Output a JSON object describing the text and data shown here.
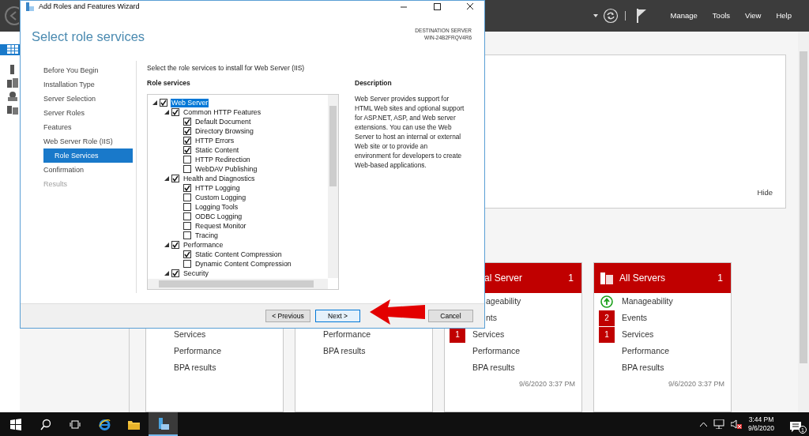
{
  "server_manager": {
    "menu": [
      "Manage",
      "Tools",
      "View",
      "Help"
    ],
    "hide_label": "Hide",
    "tiles": [
      {
        "rows": [
          {
            "kind": "plain",
            "label": "Services"
          },
          {
            "kind": "plain",
            "label": "Performance"
          },
          {
            "kind": "plain",
            "label": "BPA results"
          }
        ]
      },
      {
        "rows": [
          {
            "kind": "plain",
            "label": "Performance"
          },
          {
            "kind": "plain",
            "label": "BPA results"
          }
        ]
      },
      {
        "title": "al Server",
        "count": "1",
        "rows": [
          {
            "kind": "plain",
            "label": "ageability"
          },
          {
            "kind": "plain",
            "label": "nts"
          },
          {
            "kind": "count",
            "count": "1",
            "label": "Services"
          },
          {
            "kind": "plain",
            "label": "Performance"
          },
          {
            "kind": "plain",
            "label": "BPA results"
          }
        ],
        "timestamp": "9/6/2020 3:37 PM"
      },
      {
        "title": "All Servers",
        "count": "1",
        "rows": [
          {
            "kind": "status",
            "label": "Manageability"
          },
          {
            "kind": "count",
            "count": "2",
            "label": "Events"
          },
          {
            "kind": "count",
            "count": "1",
            "label": "Services"
          },
          {
            "kind": "plain",
            "label": "Performance"
          },
          {
            "kind": "plain",
            "label": "BPA results"
          }
        ],
        "timestamp": "9/6/2020 3:37 PM"
      }
    ]
  },
  "wizard": {
    "title": "Add Roles and Features Wizard",
    "heading": "Select role services",
    "destination_label": "DESTINATION SERVER",
    "destination_server": "WIN-24B2FRQV4R6",
    "steps": [
      {
        "label": "Before You Begin",
        "selected": false,
        "disabled": false
      },
      {
        "label": "Installation Type",
        "selected": false,
        "disabled": false
      },
      {
        "label": "Server Selection",
        "selected": false,
        "disabled": false
      },
      {
        "label": "Server Roles",
        "selected": false,
        "disabled": false
      },
      {
        "label": "Features",
        "selected": false,
        "disabled": false
      },
      {
        "label": "Web Server Role (IIS)",
        "selected": false,
        "disabled": false,
        "children": [
          {
            "label": "Role Services",
            "selected": true,
            "disabled": false
          }
        ]
      },
      {
        "label": "Confirmation",
        "selected": false,
        "disabled": false
      },
      {
        "label": "Results",
        "selected": false,
        "disabled": true
      }
    ],
    "intro": "Select the role services to install for Web Server (IIS)",
    "role_services_label": "Role services",
    "tree": [
      {
        "label": "Web Server",
        "checked": true,
        "expanded": true,
        "selected": true,
        "children": [
          {
            "label": "Common HTTP Features",
            "checked": true,
            "expanded": true,
            "selected": false,
            "children": [
              {
                "label": "Default Document",
                "checked": true,
                "selected": false
              },
              {
                "label": "Directory Browsing",
                "checked": true,
                "selected": false
              },
              {
                "label": "HTTP Errors",
                "checked": true,
                "selected": false
              },
              {
                "label": "Static Content",
                "checked": true,
                "selected": false
              },
              {
                "label": "HTTP Redirection",
                "checked": false,
                "selected": false
              },
              {
                "label": "WebDAV Publishing",
                "checked": false,
                "selected": false
              }
            ]
          },
          {
            "label": "Health and Diagnostics",
            "checked": true,
            "expanded": true,
            "selected": false,
            "children": [
              {
                "label": "HTTP Logging",
                "checked": true,
                "selected": false
              },
              {
                "label": "Custom Logging",
                "checked": false,
                "selected": false
              },
              {
                "label": "Logging Tools",
                "checked": false,
                "selected": false
              },
              {
                "label": "ODBC Logging",
                "checked": false,
                "selected": false
              },
              {
                "label": "Request Monitor",
                "checked": false,
                "selected": false
              },
              {
                "label": "Tracing",
                "checked": false,
                "selected": false
              }
            ]
          },
          {
            "label": "Performance",
            "checked": true,
            "expanded": true,
            "selected": false,
            "children": [
              {
                "label": "Static Content Compression",
                "checked": true,
                "selected": false
              },
              {
                "label": "Dynamic Content Compression",
                "checked": false,
                "selected": false
              }
            ]
          },
          {
            "label": "Security",
            "checked": true,
            "expanded": true,
            "selected": false
          }
        ]
      }
    ],
    "description_label": "Description",
    "description": "Web Server provides support for HTML Web sites and optional support for ASP.NET, ASP, and Web server extensions. You can use the Web Server to host an internal or external Web site or to provide an environment for developers to create Web-based applications.",
    "buttons": [
      {
        "label": "< Previous",
        "default": false
      },
      {
        "label": "Next >",
        "default": true
      },
      {
        "label": "Cancel",
        "default": false
      }
    ]
  },
  "taskbar": {
    "time": "3:44 PM",
    "date": "9/6/2020",
    "notification_count": "1"
  }
}
